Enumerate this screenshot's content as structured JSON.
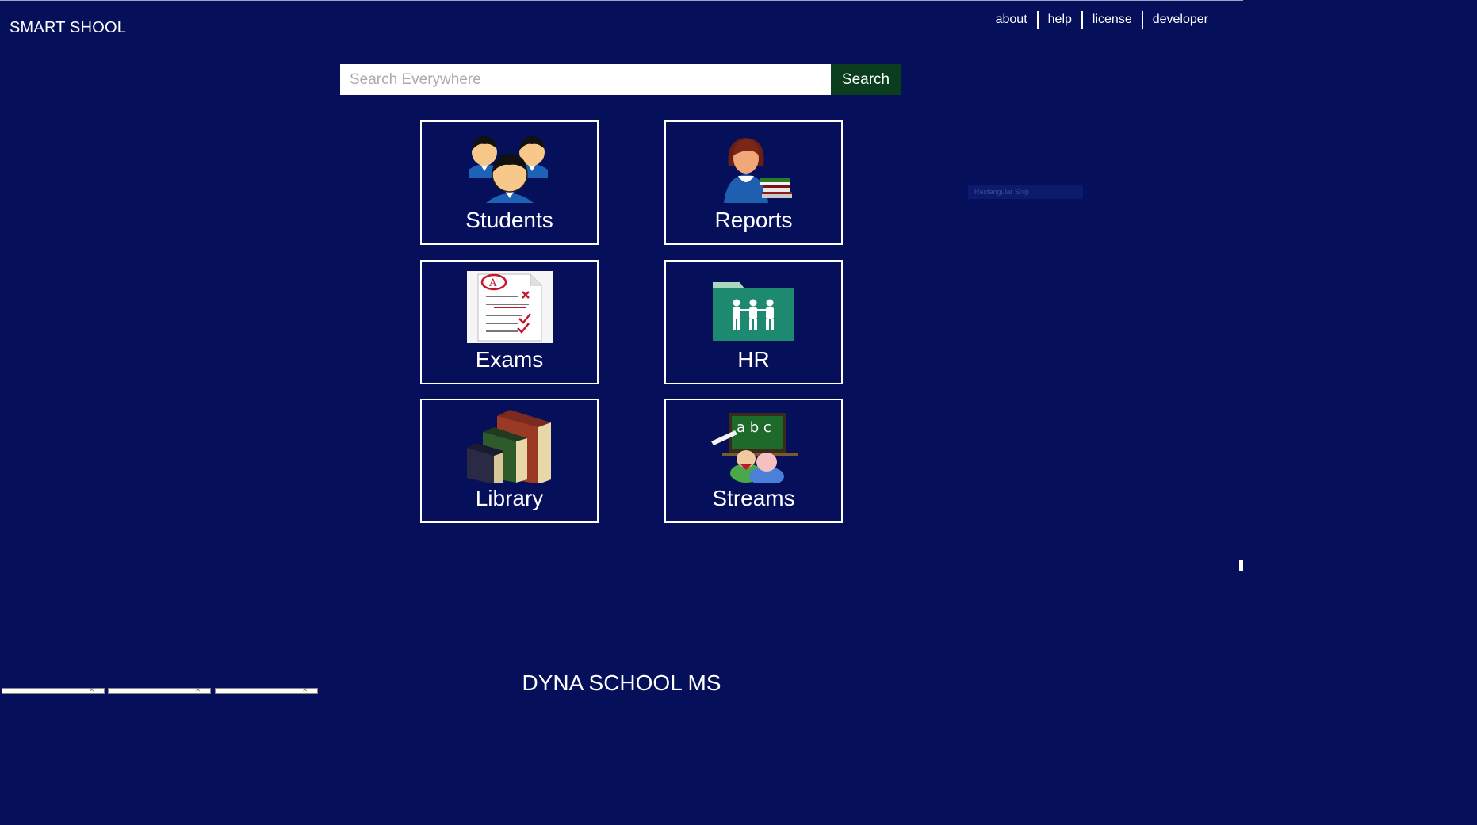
{
  "app": {
    "title": "SMART SHOOL",
    "footer_title": "DYNA SCHOOL MS",
    "background_color": "#050f5a"
  },
  "top_links": [
    {
      "label": "about"
    },
    {
      "label": "help"
    },
    {
      "label": "license"
    },
    {
      "label": "developer"
    }
  ],
  "search": {
    "placeholder": "Search Everywhere",
    "value": "",
    "button_label": "Search",
    "button_color": "#0a3d1e"
  },
  "tiles": [
    {
      "label": "Students",
      "icon": "students-group-icon"
    },
    {
      "label": "Reports",
      "icon": "teacher-with-books-icon"
    },
    {
      "label": "Exams",
      "icon": "graded-exam-paper-icon"
    },
    {
      "label": "HR",
      "icon": "people-folder-icon"
    },
    {
      "label": "Library",
      "icon": "books-icon"
    },
    {
      "label": "Streams",
      "icon": "classroom-blackboard-icon"
    }
  ],
  "overlay": {
    "ghost_tooltip": "Rectangular Snip"
  }
}
